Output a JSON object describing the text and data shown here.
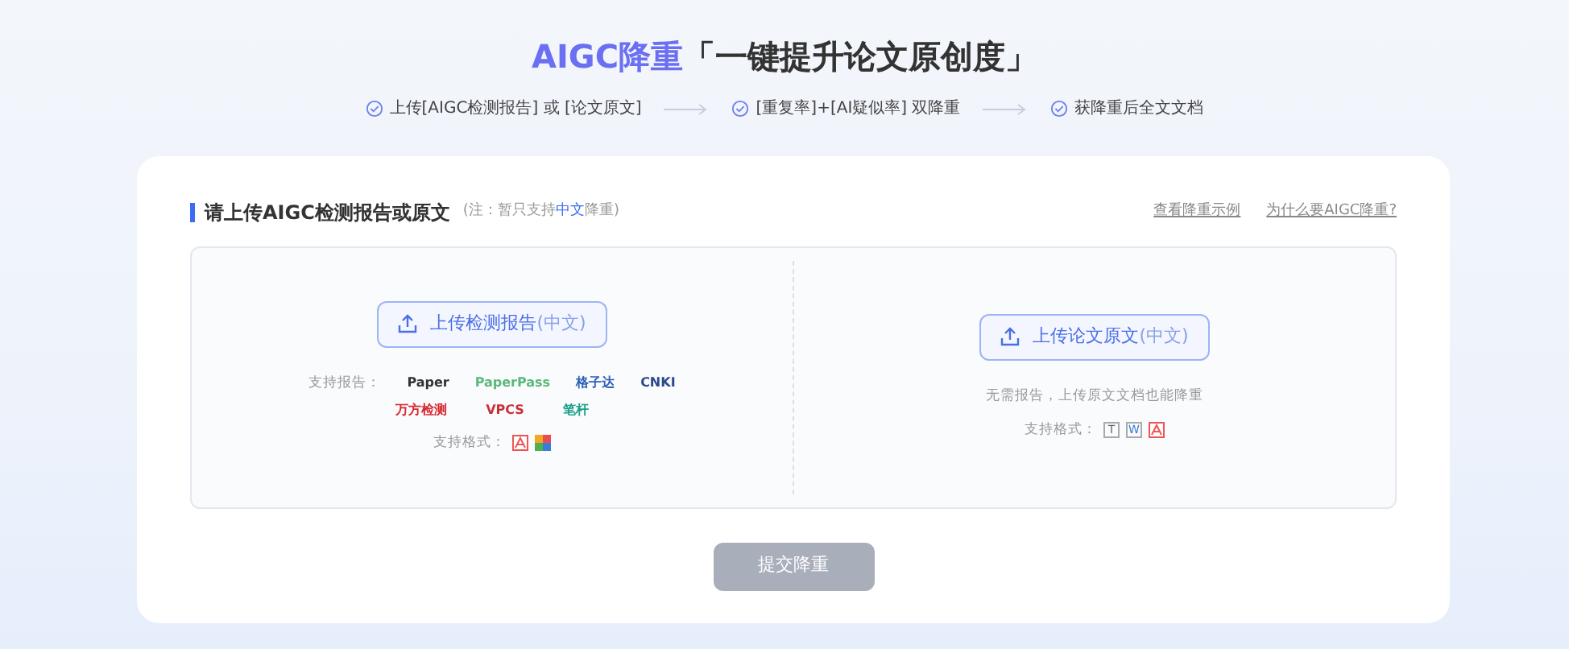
{
  "title": {
    "highlight": "AIGC降重",
    "rest": "「一键提升论文原创度」"
  },
  "steps": [
    {
      "label": "上传[AIGC检测报告] 或 [论文原文]"
    },
    {
      "label": "[重复率]+[AI疑似率] 双降重"
    },
    {
      "label": "获降重后全文文档"
    }
  ],
  "section": {
    "heading": "请上传AIGC检测报告或原文",
    "note": "(注：暂只支持**中文**降重)",
    "links": [
      "查看降重示例",
      "为什么要AIGC降重?"
    ]
  },
  "report_upload": {
    "button": "上传检测报告",
    "button_suffix": "(中文)",
    "supported_label": "支持报告：",
    "logos": [
      {
        "text": "Paper",
        "color": "#333333"
      },
      {
        "text": "PaperPass",
        "color": "#5cb87a"
      },
      {
        "text": "格子达",
        "color": "#2b5fb8"
      },
      {
        "text": "CNKI",
        "color": "#2b4a8b"
      },
      {
        "text": "万方检测",
        "color": "#d7282f"
      },
      {
        "text": "VPCS",
        "color": "#c8323a"
      },
      {
        "text": "笔杆",
        "color": "#1aa08a"
      }
    ],
    "formats_label": "支持格式：",
    "formats": [
      {
        "kind": "pdf"
      },
      {
        "kind": "image"
      }
    ]
  },
  "text_upload": {
    "button": "上传论文原文",
    "button_suffix": "(中文)",
    "hint": "无需报告，上传原文文档也能降重",
    "formats_label": "支持格式：",
    "formats": [
      {
        "kind": "letter",
        "text": "T"
      },
      {
        "kind": "letter",
        "text": "W",
        "color": "#3b7bd9"
      },
      {
        "kind": "pdf"
      }
    ]
  },
  "submit": {
    "label": "提交降重",
    "disabled": true
  }
}
